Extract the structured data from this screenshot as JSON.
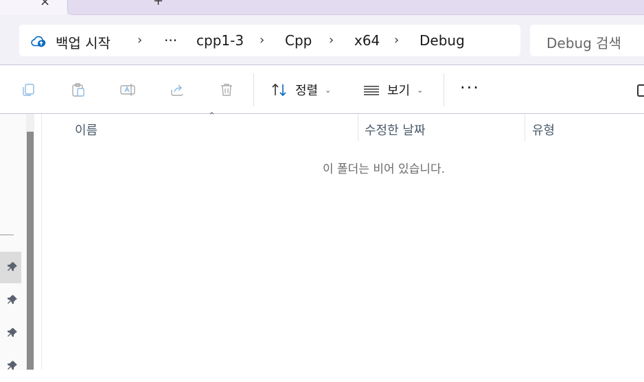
{
  "tabs": {
    "active_close": "×",
    "new_tab": "+"
  },
  "address_bar": {
    "breadcrumb": [
      "백업 시작",
      "···",
      "cpp1-3",
      "Cpp",
      "x64",
      "Debug"
    ],
    "separator": "›",
    "search_placeholder": "Debug 검색"
  },
  "toolbar": {
    "icons": [
      "copy-icon",
      "paste-icon",
      "rename-icon",
      "share-icon",
      "delete-icon"
    ],
    "sort_label": "정렬",
    "view_label": "보기",
    "more": "···"
  },
  "columns": {
    "name": "이름",
    "date_modified": "수정한 날짜",
    "type": "유형"
  },
  "empty_message": "이 폴더는 비어 있습니다.",
  "colors": {
    "accent": "#0067c0",
    "tabstrip": "#eeeaf6",
    "address_row": "#f3f1f8"
  }
}
